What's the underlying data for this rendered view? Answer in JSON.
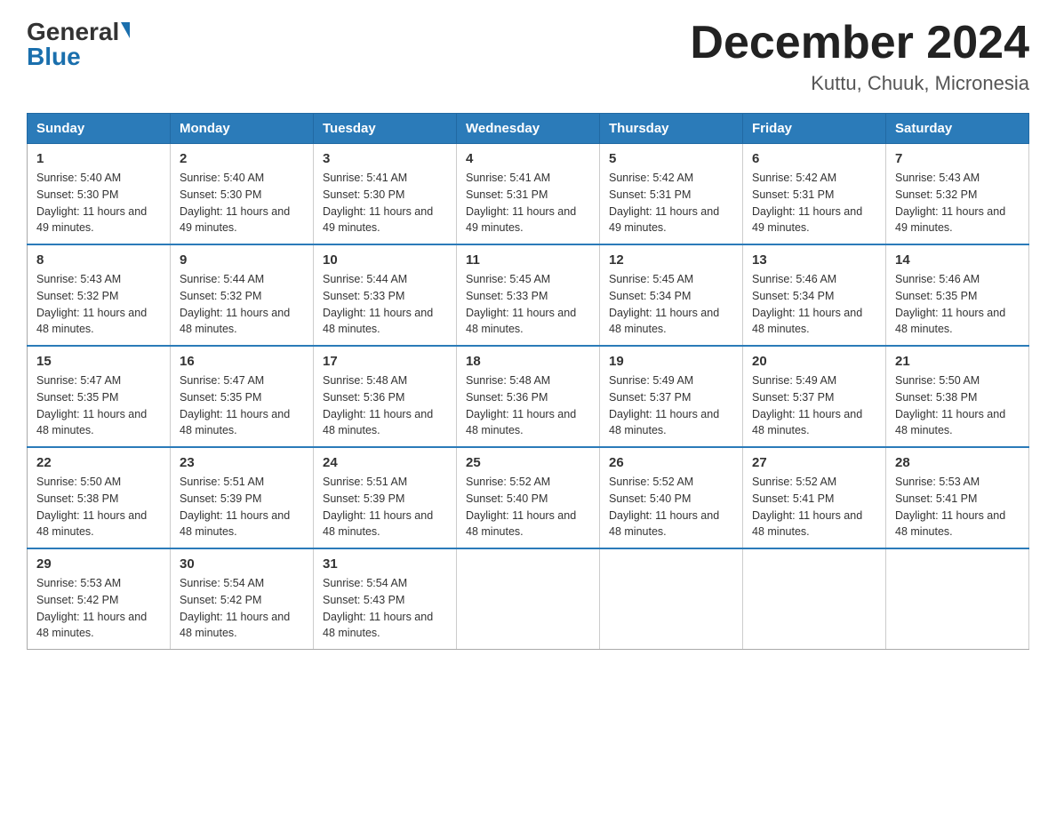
{
  "header": {
    "logo_general": "General",
    "logo_blue": "Blue",
    "month_title": "December 2024",
    "location": "Kuttu, Chuuk, Micronesia"
  },
  "days_of_week": [
    "Sunday",
    "Monday",
    "Tuesday",
    "Wednesday",
    "Thursday",
    "Friday",
    "Saturday"
  ],
  "weeks": [
    [
      {
        "day": "1",
        "sunrise": "5:40 AM",
        "sunset": "5:30 PM",
        "daylight": "11 hours and 49 minutes."
      },
      {
        "day": "2",
        "sunrise": "5:40 AM",
        "sunset": "5:30 PM",
        "daylight": "11 hours and 49 minutes."
      },
      {
        "day": "3",
        "sunrise": "5:41 AM",
        "sunset": "5:30 PM",
        "daylight": "11 hours and 49 minutes."
      },
      {
        "day": "4",
        "sunrise": "5:41 AM",
        "sunset": "5:31 PM",
        "daylight": "11 hours and 49 minutes."
      },
      {
        "day": "5",
        "sunrise": "5:42 AM",
        "sunset": "5:31 PM",
        "daylight": "11 hours and 49 minutes."
      },
      {
        "day": "6",
        "sunrise": "5:42 AM",
        "sunset": "5:31 PM",
        "daylight": "11 hours and 49 minutes."
      },
      {
        "day": "7",
        "sunrise": "5:43 AM",
        "sunset": "5:32 PM",
        "daylight": "11 hours and 49 minutes."
      }
    ],
    [
      {
        "day": "8",
        "sunrise": "5:43 AM",
        "sunset": "5:32 PM",
        "daylight": "11 hours and 48 minutes."
      },
      {
        "day": "9",
        "sunrise": "5:44 AM",
        "sunset": "5:32 PM",
        "daylight": "11 hours and 48 minutes."
      },
      {
        "day": "10",
        "sunrise": "5:44 AM",
        "sunset": "5:33 PM",
        "daylight": "11 hours and 48 minutes."
      },
      {
        "day": "11",
        "sunrise": "5:45 AM",
        "sunset": "5:33 PM",
        "daylight": "11 hours and 48 minutes."
      },
      {
        "day": "12",
        "sunrise": "5:45 AM",
        "sunset": "5:34 PM",
        "daylight": "11 hours and 48 minutes."
      },
      {
        "day": "13",
        "sunrise": "5:46 AM",
        "sunset": "5:34 PM",
        "daylight": "11 hours and 48 minutes."
      },
      {
        "day": "14",
        "sunrise": "5:46 AM",
        "sunset": "5:35 PM",
        "daylight": "11 hours and 48 minutes."
      }
    ],
    [
      {
        "day": "15",
        "sunrise": "5:47 AM",
        "sunset": "5:35 PM",
        "daylight": "11 hours and 48 minutes."
      },
      {
        "day": "16",
        "sunrise": "5:47 AM",
        "sunset": "5:35 PM",
        "daylight": "11 hours and 48 minutes."
      },
      {
        "day": "17",
        "sunrise": "5:48 AM",
        "sunset": "5:36 PM",
        "daylight": "11 hours and 48 minutes."
      },
      {
        "day": "18",
        "sunrise": "5:48 AM",
        "sunset": "5:36 PM",
        "daylight": "11 hours and 48 minutes."
      },
      {
        "day": "19",
        "sunrise": "5:49 AM",
        "sunset": "5:37 PM",
        "daylight": "11 hours and 48 minutes."
      },
      {
        "day": "20",
        "sunrise": "5:49 AM",
        "sunset": "5:37 PM",
        "daylight": "11 hours and 48 minutes."
      },
      {
        "day": "21",
        "sunrise": "5:50 AM",
        "sunset": "5:38 PM",
        "daylight": "11 hours and 48 minutes."
      }
    ],
    [
      {
        "day": "22",
        "sunrise": "5:50 AM",
        "sunset": "5:38 PM",
        "daylight": "11 hours and 48 minutes."
      },
      {
        "day": "23",
        "sunrise": "5:51 AM",
        "sunset": "5:39 PM",
        "daylight": "11 hours and 48 minutes."
      },
      {
        "day": "24",
        "sunrise": "5:51 AM",
        "sunset": "5:39 PM",
        "daylight": "11 hours and 48 minutes."
      },
      {
        "day": "25",
        "sunrise": "5:52 AM",
        "sunset": "5:40 PM",
        "daylight": "11 hours and 48 minutes."
      },
      {
        "day": "26",
        "sunrise": "5:52 AM",
        "sunset": "5:40 PM",
        "daylight": "11 hours and 48 minutes."
      },
      {
        "day": "27",
        "sunrise": "5:52 AM",
        "sunset": "5:41 PM",
        "daylight": "11 hours and 48 minutes."
      },
      {
        "day": "28",
        "sunrise": "5:53 AM",
        "sunset": "5:41 PM",
        "daylight": "11 hours and 48 minutes."
      }
    ],
    [
      {
        "day": "29",
        "sunrise": "5:53 AM",
        "sunset": "5:42 PM",
        "daylight": "11 hours and 48 minutes."
      },
      {
        "day": "30",
        "sunrise": "5:54 AM",
        "sunset": "5:42 PM",
        "daylight": "11 hours and 48 minutes."
      },
      {
        "day": "31",
        "sunrise": "5:54 AM",
        "sunset": "5:43 PM",
        "daylight": "11 hours and 48 minutes."
      },
      null,
      null,
      null,
      null
    ]
  ]
}
